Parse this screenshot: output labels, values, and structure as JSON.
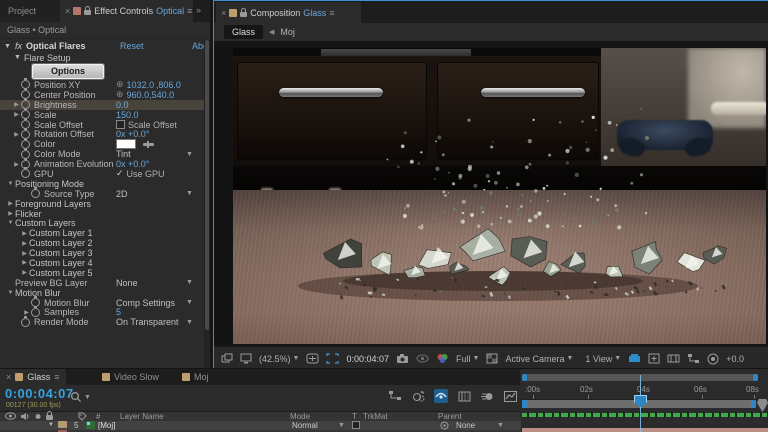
{
  "effect_controls": {
    "tab_project": "Project",
    "tab_title": "Effect Controls",
    "tab_target": "Optical",
    "overflow_chevrons": "»",
    "menu_glyph": "≡",
    "close_glyph": "×",
    "breadcrumb": "Glass • Optical",
    "effect": {
      "fx_glyph": "fx",
      "name": "Optical Flares",
      "reset_label": "Reset",
      "about_label": "Abo",
      "flare_setup_label": "Flare Setup",
      "options_label": "Options",
      "rows": [
        {
          "sw": true,
          "label": "Position XY",
          "vt": "point",
          "value": "1032.0 ,806.0"
        },
        {
          "sw": true,
          "label": "Center Position",
          "vt": "point",
          "value": "960.0,540.0"
        },
        {
          "tw": "closed",
          "sw": true,
          "label": "Brightness",
          "vt": "link",
          "value": "0.0",
          "selected": true
        },
        {
          "tw": "closed",
          "sw": true,
          "label": "Scale",
          "vt": "link",
          "value": "150.0"
        },
        {
          "sw": true,
          "label": "Scale Offset",
          "vt": "checkbox",
          "value": "Scale Offset"
        },
        {
          "tw": "closed",
          "sw": true,
          "label": "Rotation Offset",
          "vt": "link",
          "value": "0x +0.0°"
        },
        {
          "sw": true,
          "label": "Color",
          "vt": "color"
        },
        {
          "sw": true,
          "label": "Color Mode",
          "vt": "dropdown",
          "value": "Tint"
        },
        {
          "tw": "closed",
          "sw": true,
          "label": "Animation Evolution",
          "vt": "link",
          "value": "0x +0.0°"
        },
        {
          "sw": true,
          "label": "GPU",
          "vt": "check",
          "value": "Use GPU"
        },
        {
          "group": true,
          "tw": "open",
          "label": "Positioning Mode"
        },
        {
          "sw": true,
          "indent": 1,
          "label": "Source Type",
          "vt": "dropdown",
          "value": "2D"
        },
        {
          "group": true,
          "tw": "closed",
          "label": "Foreground Layers"
        },
        {
          "group": true,
          "tw": "closed",
          "label": "Flicker"
        },
        {
          "group": true,
          "tw": "open",
          "label": "Custom Layers"
        },
        {
          "group": true,
          "tw": "closed",
          "indent": 1,
          "label": "Custom Layer 1"
        },
        {
          "group": true,
          "tw": "closed",
          "indent": 1,
          "label": "Custom Layer 2"
        },
        {
          "group": true,
          "tw": "closed",
          "indent": 1,
          "label": "Custom Layer 3"
        },
        {
          "group": true,
          "tw": "closed",
          "indent": 1,
          "label": "Custom Layer 4"
        },
        {
          "group": true,
          "tw": "closed",
          "indent": 1,
          "label": "Custom Layer 5"
        },
        {
          "plain": true,
          "label": "Preview BG Layer",
          "vt": "dropdown",
          "value": "None"
        },
        {
          "group": true,
          "tw": "open",
          "label": "Motion Blur"
        },
        {
          "sw": true,
          "indent": 1,
          "label": "Motion Blur",
          "vt": "dropdown",
          "value": "Comp Settings"
        },
        {
          "tw": "closed",
          "sw": true,
          "indent": 1,
          "label": "Samples",
          "vt": "link",
          "value": "5"
        },
        {
          "sw": true,
          "label": "Render Mode",
          "vt": "dropdown",
          "value": "On Transparent"
        }
      ]
    }
  },
  "composition": {
    "tab_title": "Composition",
    "tab_target": "Glass",
    "nav_current": "Glass",
    "nav_back_glyph": "◀",
    "nav_parent": "Moj",
    "toolbar": {
      "zoom": "(42.5%)",
      "timecode": "0:00:04:07",
      "resolution": "Full",
      "camera": "Active Camera",
      "view": "1 View",
      "exposure": "+0.0"
    },
    "scene_description": "Slow-motion frame of glass shattering on a mauve carpet in front of a dark TV cabinet; game controller at right"
  },
  "timeline": {
    "tabs": [
      {
        "label": "Glass",
        "active": true
      },
      {
        "label": "Video Slow",
        "active": false
      },
      {
        "label": "Moj",
        "active": false
      }
    ],
    "timecode": "0:00:04:07",
    "frame_info": "00127 (30.00 fps)",
    "columns": {
      "number": "#",
      "layer_name": "Layer Name",
      "mode": "Mode",
      "t": "T",
      "trkmat": "TrkMat",
      "parent": "Parent"
    },
    "layers": [
      {
        "number": "5",
        "name": "[Moj]",
        "mode": "Normal",
        "parent": "None"
      }
    ],
    "ruler_labels": [
      ":00s",
      "02s",
      "04s",
      "06s",
      "08s"
    ]
  },
  "colors": {
    "accent_blue": "#6ba7d9",
    "timecode_blue": "#35a3e0",
    "cache_green": "#3fae4a",
    "selection_border": "#3f8fd0",
    "comp_label_tan": "#bfa06c",
    "ec_label_red": "#b5766b"
  }
}
